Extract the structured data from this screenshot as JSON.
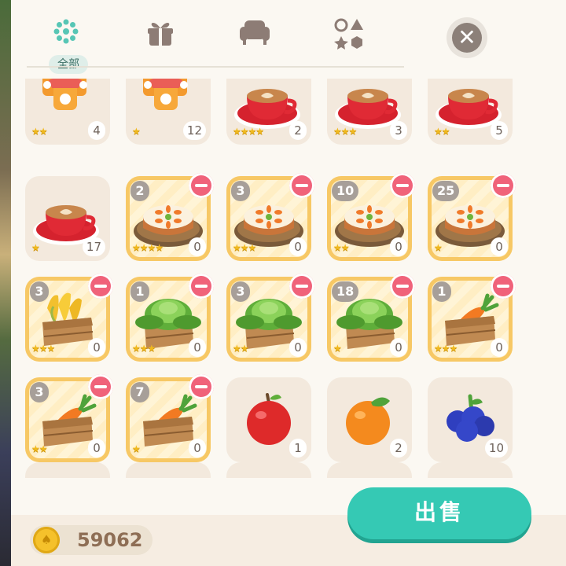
{
  "tabs": [
    {
      "id": "all",
      "icon": "dots-flower-icon",
      "label": "全部",
      "active": true
    },
    {
      "id": "gift",
      "icon": "gift-box-icon",
      "label": "",
      "active": false
    },
    {
      "id": "furniture",
      "icon": "armchair-icon",
      "label": "",
      "active": false
    },
    {
      "id": "shapes",
      "icon": "shapes-icon",
      "label": "",
      "active": false
    }
  ],
  "close_icon": "close-icon",
  "items": [
    [
      {
        "art": "jam-jars",
        "stars": "★★",
        "count": "4",
        "selected": false
      },
      {
        "art": "jam-jars",
        "stars": "★",
        "count": "12",
        "selected": false
      },
      {
        "art": "coffee-cup",
        "stars": "★★★★",
        "count": "2",
        "selected": false
      },
      {
        "art": "coffee-cup",
        "stars": "★★★",
        "count": "3",
        "selected": false
      },
      {
        "art": "coffee-cup",
        "stars": "★★",
        "count": "5",
        "selected": false
      }
    ],
    [
      {
        "art": "coffee-cup",
        "stars": "★",
        "count": "17",
        "selected": false
      },
      {
        "art": "carrot-cake",
        "stars": "★★★★",
        "count": "0",
        "selected": true,
        "sel_count": "2"
      },
      {
        "art": "carrot-cake",
        "stars": "★★★",
        "count": "0",
        "selected": true,
        "sel_count": "3"
      },
      {
        "art": "carrot-cake",
        "stars": "★★",
        "count": "0",
        "selected": true,
        "sel_count": "10"
      },
      {
        "art": "carrot-cake",
        "stars": "★",
        "count": "0",
        "selected": true,
        "sel_count": "25"
      }
    ],
    [
      {
        "art": "corn-crate",
        "stars": "★★★",
        "count": "0",
        "selected": true,
        "sel_count": "3"
      },
      {
        "art": "cabbage-crate",
        "stars": "★★★",
        "count": "0",
        "selected": true,
        "sel_count": "1"
      },
      {
        "art": "cabbage-crate",
        "stars": "★★",
        "count": "0",
        "selected": true,
        "sel_count": "3"
      },
      {
        "art": "cabbage-crate",
        "stars": "★",
        "count": "0",
        "selected": true,
        "sel_count": "18"
      },
      {
        "art": "carrot-crate",
        "stars": "★★★",
        "count": "0",
        "selected": true,
        "sel_count": "1"
      }
    ],
    [
      {
        "art": "carrot-crate",
        "stars": "★★",
        "count": "0",
        "selected": true,
        "sel_count": "3"
      },
      {
        "art": "carrot-crate",
        "stars": "★",
        "count": "0",
        "selected": true,
        "sel_count": "7"
      },
      {
        "art": "apple",
        "stars": "",
        "count": "1",
        "selected": false
      },
      {
        "art": "orange",
        "stars": "",
        "count": "2",
        "selected": false
      },
      {
        "art": "blueberries",
        "stars": "",
        "count": "10",
        "selected": false
      }
    ]
  ],
  "coins": {
    "icon": "acorn-coin-icon",
    "value": "59062"
  },
  "sell_button": {
    "label": "出售"
  }
}
